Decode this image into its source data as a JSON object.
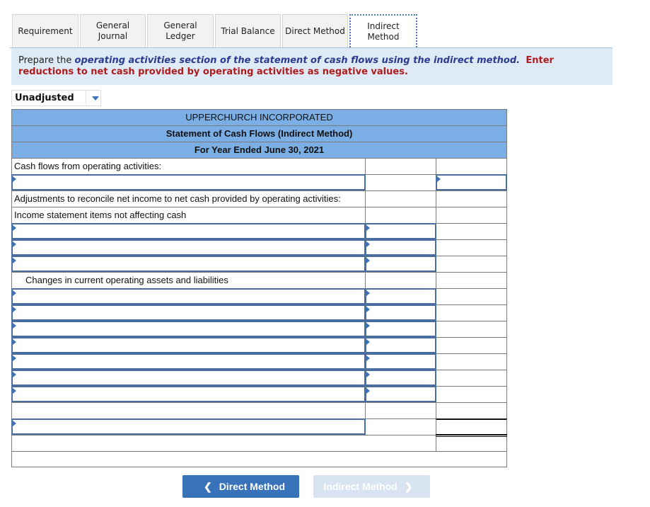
{
  "tabs": [
    {
      "label": "Requirement",
      "active": false
    },
    {
      "label": "General Journal",
      "active": false
    },
    {
      "label": "General Ledger",
      "active": false
    },
    {
      "label": "Trial Balance",
      "active": false
    },
    {
      "label": "Direct Method",
      "active": false
    },
    {
      "label": "Indirect Method",
      "active": true
    }
  ],
  "instructions": {
    "prefix": "Prepare the ",
    "emphasis": "operating activities section of the statement of cash flows using the indirect method.",
    "warning": "Enter reductions to net cash provided by operating activities as negative values."
  },
  "dropdown": {
    "selected": "Unadjusted"
  },
  "statement": {
    "company": "UPPERCHURCH INCORPORATED",
    "title": "Statement of Cash Flows (Indirect Method)",
    "period": "For Year Ended June 30, 2021",
    "labels": {
      "operating": "Cash flows from operating activities:",
      "adjustments": "Adjustments to reconcile net income to net cash provided by operating activities:",
      "noncash": "Income statement items not affecting cash",
      "changes": "Changes in current operating assets and liabilities"
    }
  },
  "nav": {
    "prev_label": "Direct Method",
    "next_label": "Indirect Method",
    "prev_icon": "chevron-left-icon",
    "next_icon": "chevron-right-icon"
  },
  "colors": {
    "accent": "#3872b8",
    "header_bg": "#7aaee4",
    "instr_bg": "#deebf7",
    "warning": "#b01c1c"
  }
}
